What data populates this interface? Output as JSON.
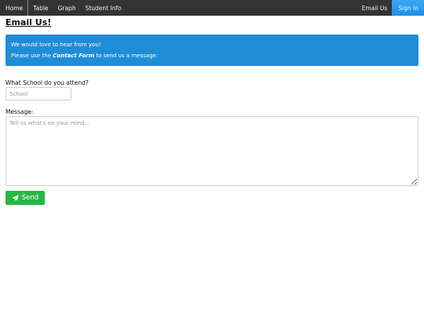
{
  "nav": {
    "left": [
      "Home",
      "Table",
      "Graph",
      "Student Info"
    ],
    "email_us": "Email Us",
    "sign_in": "Sign In"
  },
  "page": {
    "title": "Email Us!"
  },
  "alert": {
    "line1": "We would love to hear from you!",
    "line2_prefix": "Please use the ",
    "line2_strong": "Contact Form",
    "line2_suffix": " to send us a message."
  },
  "form": {
    "school_label": "What School do you attend?",
    "school_placeholder": "School",
    "message_label": "Message:",
    "message_placeholder": "Tell us what's on your mind...",
    "send_label": "Send",
    "send_icon": "paper-plane-icon"
  },
  "colors": {
    "navbar": "#333333",
    "sign_in": "#2196f3",
    "alert": "#1f8dd6",
    "send": "#27b844"
  }
}
